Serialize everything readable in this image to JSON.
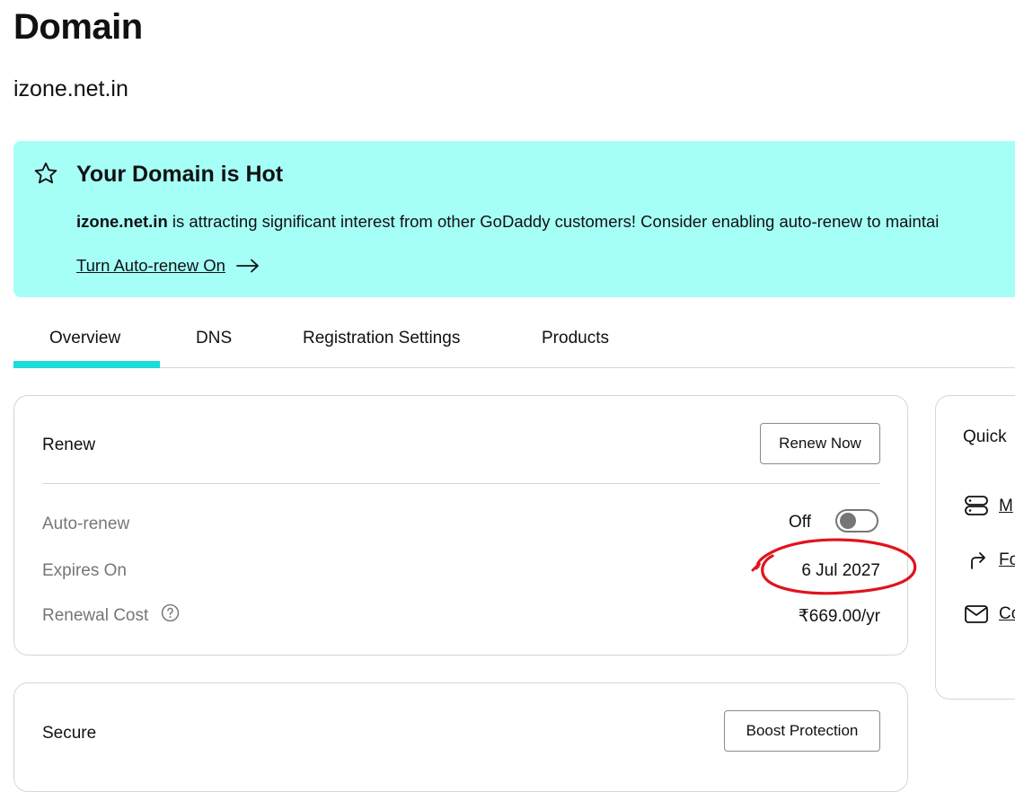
{
  "page": {
    "title": "Domain",
    "domain": "izone.net.in"
  },
  "banner": {
    "icon": "star-icon",
    "title": "Your Domain is Hot",
    "desc_domain": "izone.net.in",
    "desc_text": " is attracting significant interest from other GoDaddy customers! Consider enabling auto-renew to maintai",
    "link": "Turn Auto-renew On",
    "background": "#a6fff7"
  },
  "tabs": [
    {
      "label": "Overview",
      "active": true
    },
    {
      "label": "DNS",
      "active": false
    },
    {
      "label": "Registration Settings",
      "active": false
    },
    {
      "label": "Products",
      "active": false
    }
  ],
  "renew": {
    "title": "Renew",
    "button": "Renew Now",
    "rows": {
      "auto_renew_label": "Auto-renew",
      "auto_renew_value": "Off",
      "auto_renew_on": false,
      "expires_label": "Expires On",
      "expires_value": "6 Jul 2027",
      "cost_label": "Renewal Cost",
      "cost_value": "₹669.00/yr"
    }
  },
  "secure": {
    "title": "Secure",
    "button": "Boost Protection"
  },
  "quick": {
    "title": "Quick",
    "links": [
      {
        "icon": "server-icon",
        "label": "M"
      },
      {
        "icon": "forward-arrow-icon",
        "label": "Fo"
      },
      {
        "icon": "mail-icon",
        "label": "Co"
      }
    ]
  },
  "annotation_color": "#e0141e",
  "accent_color": "#1bdbdb"
}
